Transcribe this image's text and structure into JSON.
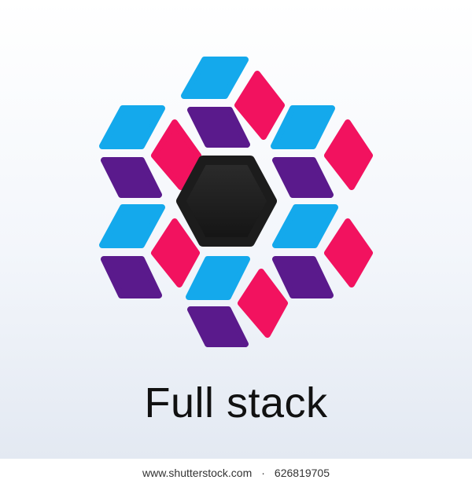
{
  "logo": {
    "colors": {
      "blue": "#14a9ec",
      "pink": "#f2125f",
      "purple": "#5a1a8c",
      "center": "#1c1c1c"
    }
  },
  "title": "Full stack",
  "footer": {
    "site": "www.shutterstock.com",
    "separator": "·",
    "image_number": "626819705"
  }
}
